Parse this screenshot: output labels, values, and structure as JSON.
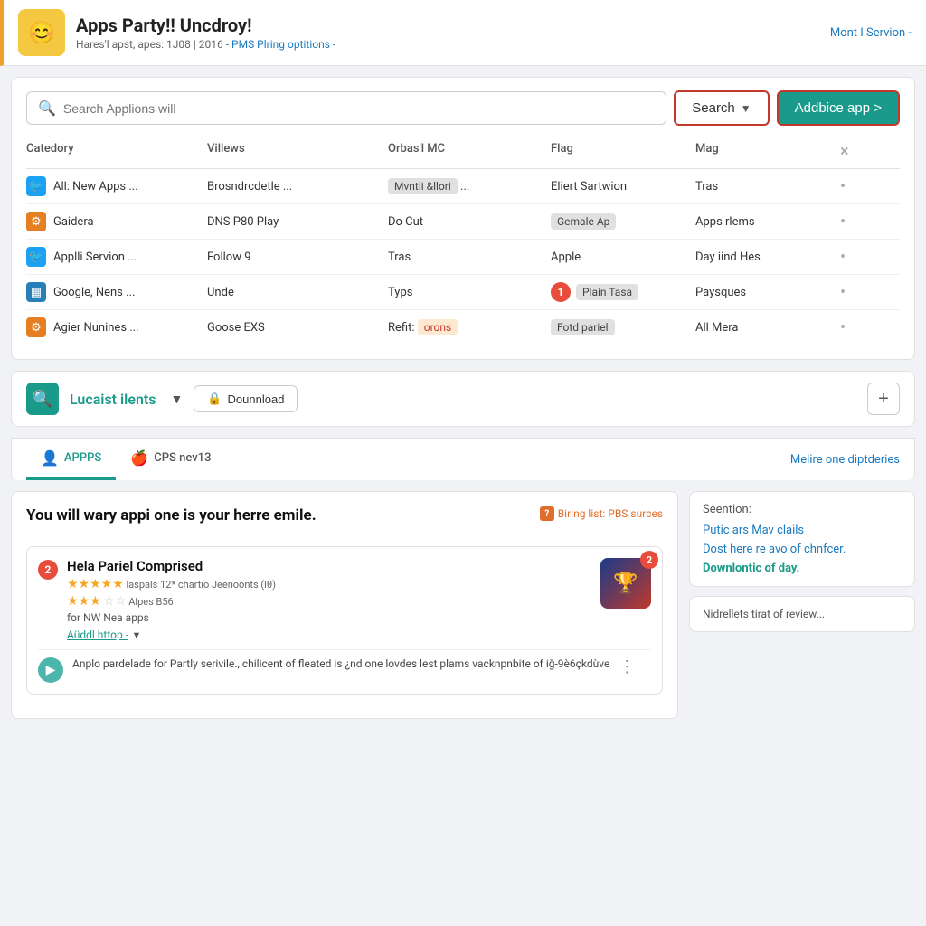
{
  "header": {
    "avatar_emoji": "😊",
    "title": "Apps Party!! Uncdroy!",
    "subtitle": "Hares'l apst, apes: 1J08 | 2016 -",
    "pms_link": "PMS Plring optitions -",
    "user_link": "Mont I Servion -"
  },
  "search": {
    "input_placeholder": "Search Applions will",
    "search_label": "Search",
    "add_label": "Addbice app >"
  },
  "table": {
    "headers": [
      "Catedory",
      "Villews",
      "Orbas'l MC",
      "Flag",
      "Mag",
      ""
    ],
    "rows": [
      {
        "icon": "twitter",
        "category": "All: New Apps ...",
        "views": "Brosndrcdetle ...",
        "mc": "Mvntli &llori ...",
        "mc_tag": true,
        "flag": "Eliert Sartwion",
        "mag": "Tras",
        "dot": "•"
      },
      {
        "icon": "orange",
        "category": "Gaidera",
        "views": "DNS P80 Play",
        "mc": "Do Cut",
        "mc_tag": false,
        "flag": "Gemale Ap",
        "flag_tag": true,
        "mag": "Apps rlems",
        "dot": "•"
      },
      {
        "icon": "twitter",
        "category": "Applli Servion ...",
        "views": "Follow 9",
        "mc": "Tras",
        "mc_tag": false,
        "flag": "Apple",
        "mag": "Day iind Hes",
        "dot": "•"
      },
      {
        "icon": "blue2",
        "category": "Google, Nens ...",
        "views": "Unde",
        "mc": "Typs",
        "mc_tag": false,
        "flag": "Plain Tasa",
        "flag_tag": true,
        "mag": "Paysques",
        "badge": "1",
        "dot": "•"
      },
      {
        "icon": "orange2",
        "category": "Agier Nunines ...",
        "views": "Goose EXS",
        "mc": "Refit: orons",
        "mc_tag_orange": true,
        "flag": "Fotd pariel",
        "flag_tag": true,
        "mag": "All Mera",
        "dot": "•"
      }
    ]
  },
  "filter": {
    "title": "Lucaist ilents",
    "download_label": "Dounnload",
    "plus_label": "+"
  },
  "tabs": {
    "items": [
      {
        "label": "APPPS",
        "icon": "👤",
        "active": true
      },
      {
        "label": "CPS nev13",
        "icon": "🍎",
        "active": false
      }
    ],
    "right_link": "Melire one diptderies"
  },
  "main": {
    "title": "You will wary appi one is your herre emile.",
    "biring_label": "Biring list: PBS surces",
    "app_card": {
      "badge": "2",
      "name": "Hela Pariel Comprised",
      "rating_full": "★★★★★",
      "rating_meta": "laspals 12* chartio Jeenoonts (lθ)",
      "rating2": "★★★",
      "rating2_gray": "☆☆",
      "rating2_meta": "Alpes B56",
      "sub": "for NW Nea apps",
      "link": "Aüddl httop -",
      "thumb_badge": "2",
      "desc": "Anplo pardelade for Partly serivile., chilicent of fleated is ¿nd one lovdes lest plams vacknpnbite of iğ-9è6çkdùve"
    }
  },
  "sidebar": {
    "title": "Seention:",
    "links": [
      {
        "text": "Putic ars Mav clails",
        "style": "normal"
      },
      {
        "text": "Dost here re avo of chnfcer.",
        "style": "normal"
      },
      {
        "text": "Downlontic of day.",
        "style": "bold-teal"
      }
    ],
    "preview_text": "Nidrellets tirat of review..."
  }
}
